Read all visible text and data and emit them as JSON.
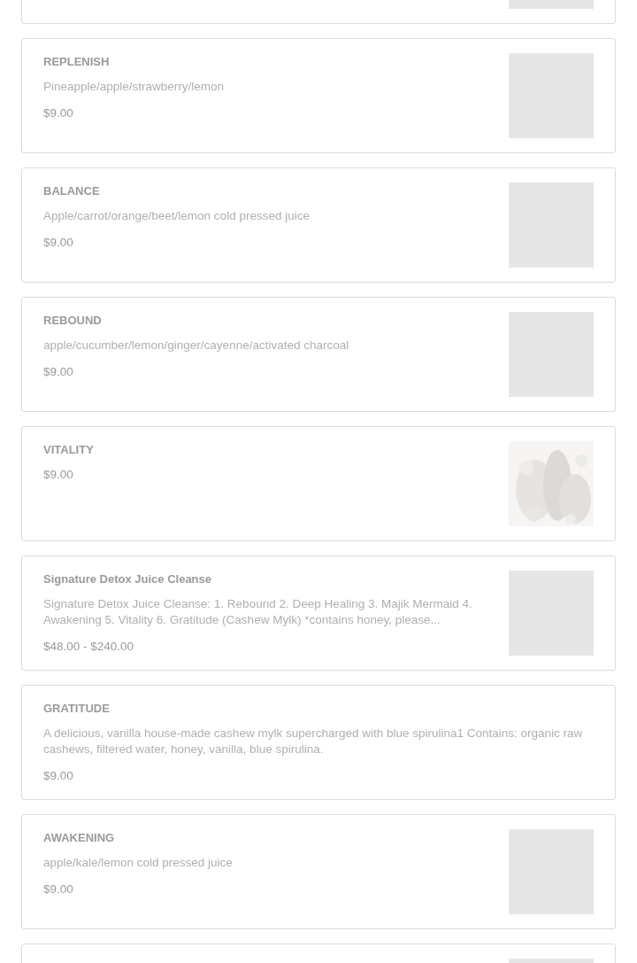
{
  "products": [
    {
      "kind": "placeholder"
    },
    {
      "name": "REPLENISH",
      "description": "Pineapple/apple/strawberry/lemon",
      "price": "$9.00",
      "kind": "placeholder"
    },
    {
      "name": "BALANCE",
      "description": "Apple/carrot/orange/beet/lemon cold pressed juice",
      "price": "$9.00",
      "kind": "placeholder"
    },
    {
      "name": "REBOUND",
      "description": "apple/cucumber/lemon/ginger/cayenne/activated charcoal",
      "price": "$9.00",
      "kind": "placeholder"
    },
    {
      "name": "VITALITY",
      "price": "$9.00",
      "kind": "picture"
    },
    {
      "name": "Signature Detox Juice Cleanse",
      "description": "Signature Detox Juice Cleanse: 1. Rebound 2. Deep Healing 3. Majik Mermaid 4. Awakening 5. Vitality 6. Gratitude (Cashew Mylk) *contains honey, please...",
      "price": "$48.00 - $240.00",
      "kind": "placeholder"
    },
    {
      "name": "GRATITUDE",
      "description": "A delicious, vanilla house-made cashew mylk supercharged with blue spirulina1 Contains: organic raw cashews, filtered water, honey, vanilla, blue spirulina.",
      "price": "$9.00",
      "kind": "text"
    },
    {
      "name": "AWAKENING",
      "description": "apple/kale/lemon cold pressed juice",
      "price": "$9.00",
      "kind": "placeholder"
    },
    {
      "kind": "placeholder"
    }
  ]
}
